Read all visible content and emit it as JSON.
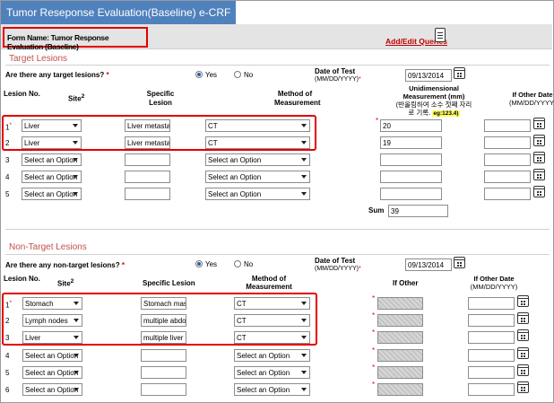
{
  "header": {
    "title": "Tumor Reseponse Evaluation(Baseline)  e-CRF"
  },
  "form": {
    "name": "Form Name: Tumor Response Evaluation (Baseline)",
    "add_edit_queries": "Add/Edit Queries"
  },
  "target": {
    "section_title": "Target Lesions",
    "question": "Are there any target lesions?",
    "yes_label": "Yes",
    "no_label": "No",
    "selected": "Yes",
    "date_label": "Date of Test",
    "date_format": "(MM/DD/YYYY)",
    "date_value": "09/13/2014",
    "col_lesion_no": "Lesion No.",
    "col_site": "Site",
    "col_specific": "Specific Lesion",
    "col_method": "Method of Measurement",
    "col_unidim": "Unidimensional Measurement (mm)",
    "col_unidim_note": "(반올림하여 소수 첫째 자리로 기록.",
    "col_unidim_eg": "eg:123.4)",
    "col_other_date": "If Other Date",
    "col_other_date_fmt": "(MM/DD/YYYY)",
    "rows": [
      {
        "no": "1",
        "site": "Liver",
        "specific": "Liver metastasis",
        "method": "CT",
        "measurement": "20"
      },
      {
        "no": "2",
        "site": "Liver",
        "specific": "Liver metastasis",
        "method": "CT",
        "measurement": "19"
      },
      {
        "no": "3",
        "site": "Select an Option",
        "specific": "",
        "method": "Select an Option",
        "measurement": ""
      },
      {
        "no": "4",
        "site": "Select an Option",
        "specific": "",
        "method": "Select an Option",
        "measurement": ""
      },
      {
        "no": "5",
        "site": "Select an Option",
        "specific": "",
        "method": "Select an Option",
        "measurement": ""
      }
    ],
    "sum_label": "Sum",
    "sum_value": "39"
  },
  "nontarget": {
    "section_title": "Non-Target Lesions",
    "question": "Are there any non-target lesions?",
    "yes_label": "Yes",
    "no_label": "No",
    "selected": "Yes",
    "date_label": "Date of Test",
    "date_format": "(MM/DD/YYYY)",
    "date_value": "09/13/2014",
    "col_lesion_no": "Lesion No.",
    "col_site": "Site",
    "col_specific": "Specific Lesion",
    "col_method": "Method of Measurement",
    "col_if_other": "If Other",
    "col_other_date": "If Other Date",
    "col_other_date_fmt": "(MM/DD/YYYY)",
    "rows": [
      {
        "no": "1",
        "site": "Stomach",
        "specific": "Stomach mass",
        "method": "CT"
      },
      {
        "no": "2",
        "site": "Lymph nodes",
        "specific": "multiple abdomi",
        "method": "CT"
      },
      {
        "no": "3",
        "site": "Liver",
        "specific": "multiple liver me",
        "method": "CT"
      },
      {
        "no": "4",
        "site": "Select an Option",
        "specific": "",
        "method": "Select an Option"
      },
      {
        "no": "5",
        "site": "Select an Option",
        "specific": "",
        "method": "Select an Option"
      },
      {
        "no": "6",
        "site": "Select an Option",
        "specific": "",
        "method": "Select an Option"
      }
    ]
  }
}
